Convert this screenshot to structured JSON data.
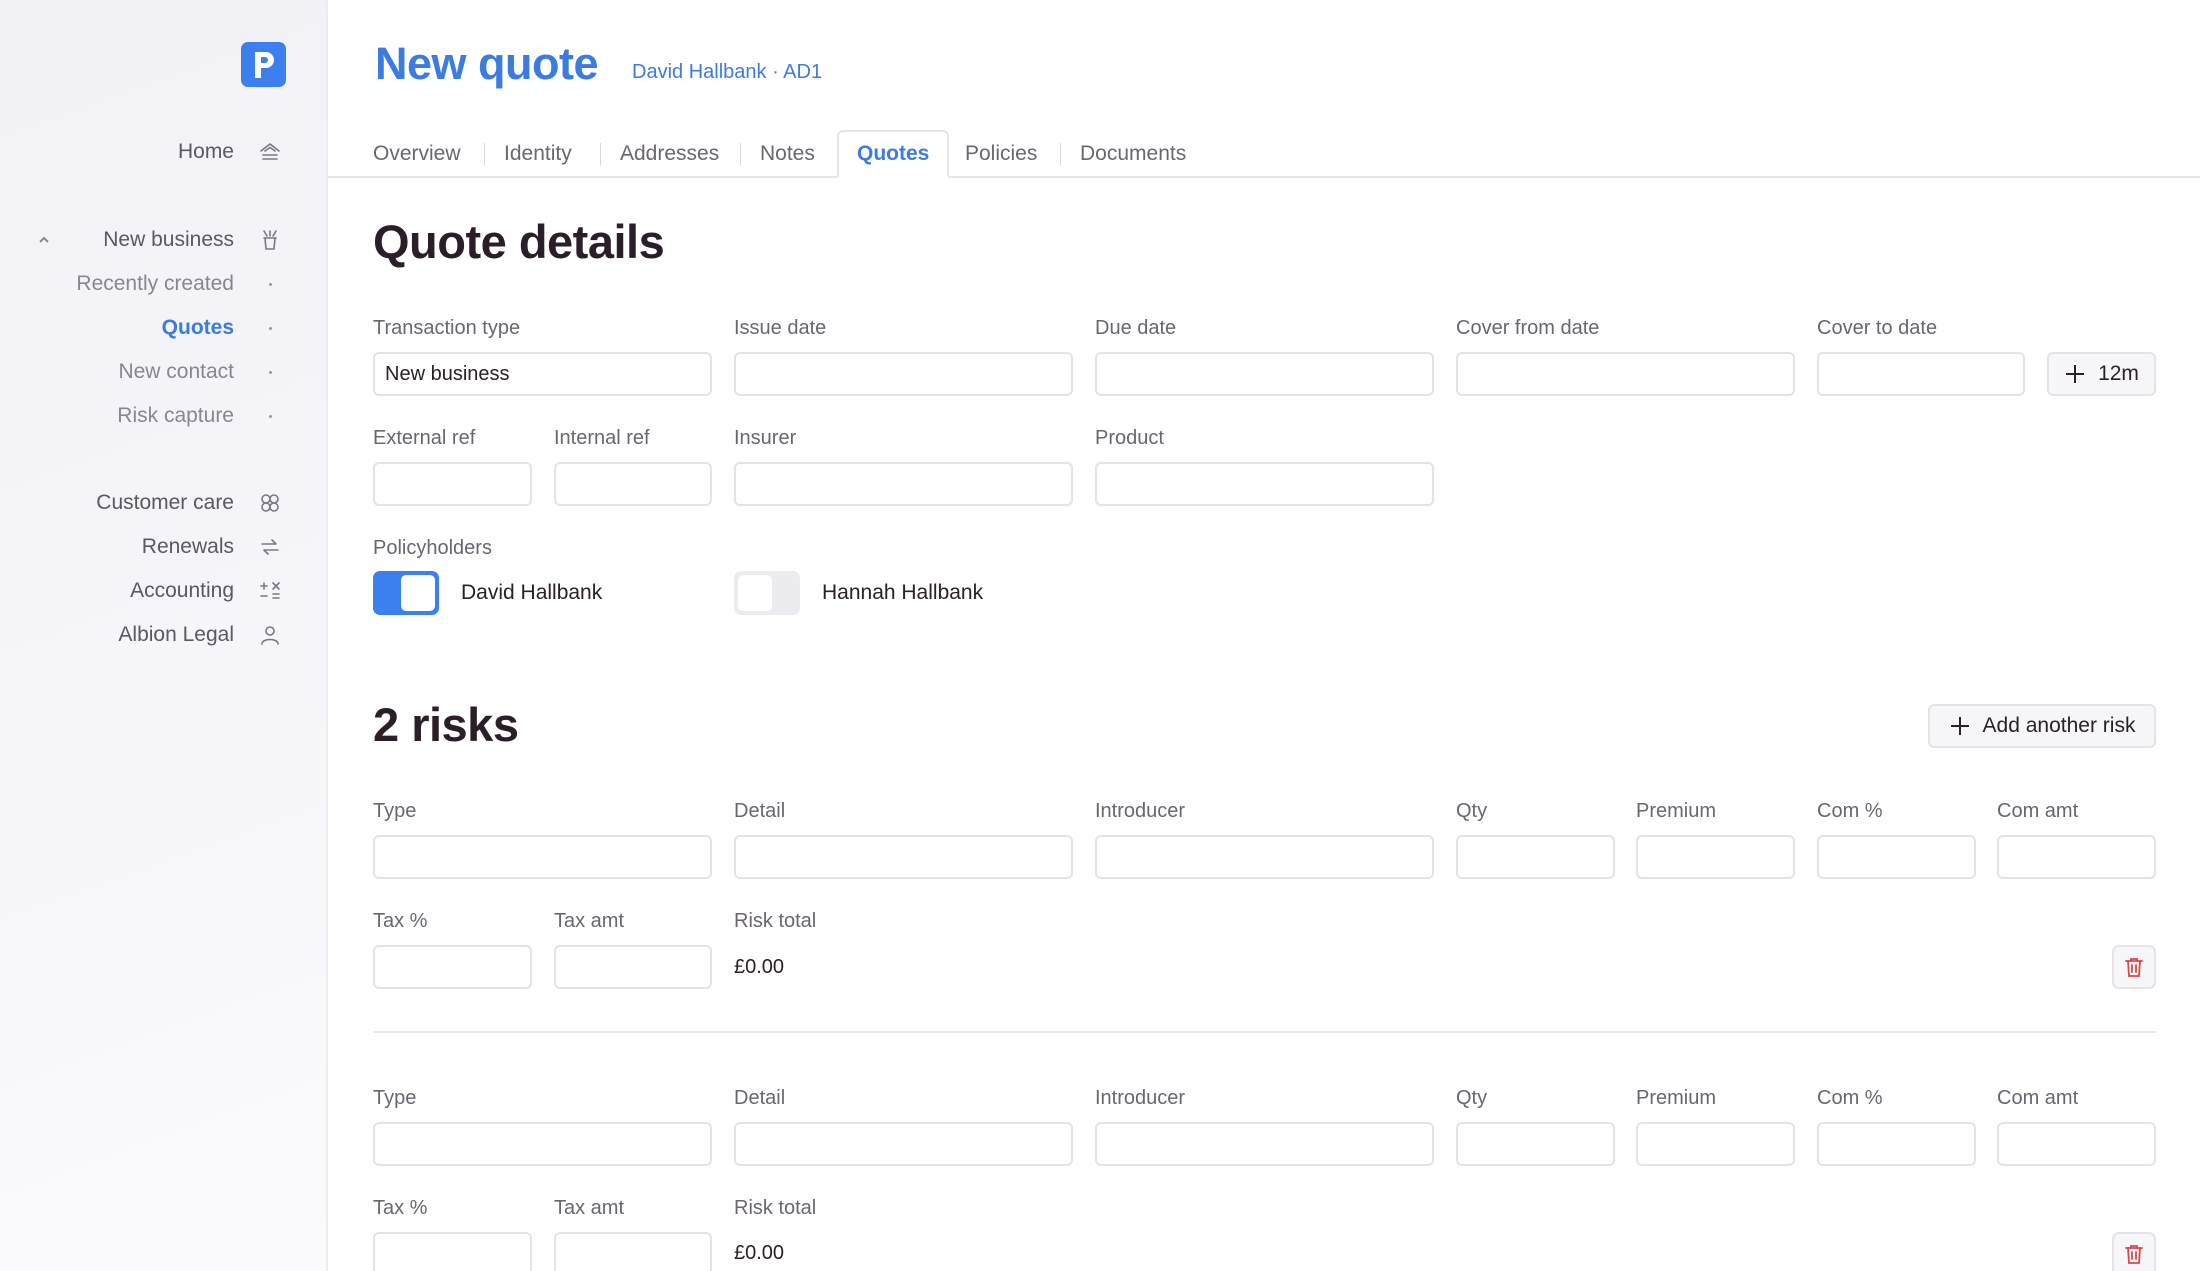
{
  "sidebar": {
    "logo_letter": "P",
    "items": [
      {
        "label": "Home",
        "icon": "home-icon"
      },
      {
        "label": "New business",
        "icon": "new-business-icon"
      },
      {
        "label": "Recently created"
      },
      {
        "label": "Quotes"
      },
      {
        "label": "New contact"
      },
      {
        "label": "Risk capture"
      },
      {
        "label": "Customer care",
        "icon": "customer-care-icon"
      },
      {
        "label": "Renewals",
        "icon": "renewals-icon"
      },
      {
        "label": "Accounting",
        "icon": "accounting-icon"
      },
      {
        "label": "Albion Legal",
        "icon": "user-icon"
      }
    ]
  },
  "header": {
    "title": "New quote",
    "subtitle": "David Hallbank · AD1"
  },
  "tabs": [
    "Overview",
    "Identity",
    "Addresses",
    "Notes",
    "Quotes",
    "Policies",
    "Documents"
  ],
  "active_tab": "Quotes",
  "quote_details": {
    "heading": "Quote details",
    "transaction_type_label": "Transaction type",
    "transaction_type_value": "New business",
    "issue_date_label": "Issue date",
    "due_date_label": "Due date",
    "cover_from_label": "Cover from date",
    "cover_to_label": "Cover to date",
    "add_12m_label": "12m",
    "external_ref_label": "External ref",
    "internal_ref_label": "Internal ref",
    "insurer_label": "Insurer",
    "product_label": "Product",
    "policyholders_label": "Policyholders",
    "policyholders": [
      {
        "name": "David Hallbank",
        "selected": true
      },
      {
        "name": "Hannah Hallbank",
        "selected": false
      }
    ]
  },
  "risks": {
    "heading": "2 risks",
    "add_label": "Add another risk",
    "labels": {
      "type": "Type",
      "detail": "Detail",
      "introducer": "Introducer",
      "qty": "Qty",
      "premium": "Premium",
      "com_pct": "Com %",
      "com_amt": "Com amt",
      "tax_pct": "Tax %",
      "tax_amt": "Tax amt",
      "risk_total": "Risk total"
    },
    "items": [
      {
        "risk_total": "£0.00"
      },
      {
        "risk_total": "£0.00"
      }
    ]
  },
  "colors": {
    "accent": "#3c80f0",
    "accent_text": "#3c7be0",
    "danger": "#d84848"
  }
}
